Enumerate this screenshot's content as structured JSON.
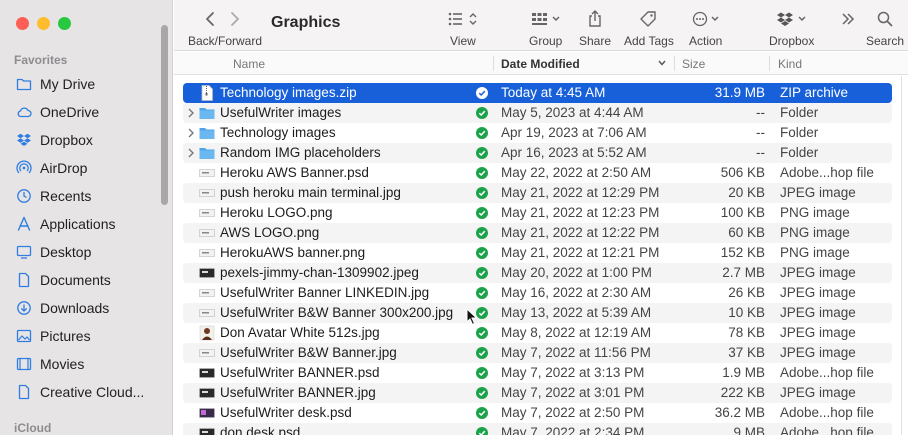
{
  "toolbar": {
    "title": "Graphics",
    "back_forward_label": "Back/Forward",
    "view_label": "View",
    "group_label": "Group",
    "share_label": "Share",
    "add_tags_label": "Add Tags",
    "action_label": "Action",
    "dropbox_label": "Dropbox",
    "search_label": "Search"
  },
  "sidebar": {
    "favorites_header": "Favorites",
    "icloud_header": "iCloud",
    "items": [
      {
        "label": "My Drive",
        "icon": "drive-folder-icon"
      },
      {
        "label": "OneDrive",
        "icon": "cloud-icon"
      },
      {
        "label": "Dropbox",
        "icon": "dropbox-icon"
      },
      {
        "label": "AirDrop",
        "icon": "airdrop-icon"
      },
      {
        "label": "Recents",
        "icon": "clock-icon"
      },
      {
        "label": "Applications",
        "icon": "applications-icon"
      },
      {
        "label": "Desktop",
        "icon": "desktop-icon"
      },
      {
        "label": "Documents",
        "icon": "document-icon"
      },
      {
        "label": "Downloads",
        "icon": "download-icon"
      },
      {
        "label": "Pictures",
        "icon": "pictures-icon"
      },
      {
        "label": "Movies",
        "icon": "movies-icon"
      },
      {
        "label": "Creative Cloud...",
        "icon": "file-icon"
      }
    ]
  },
  "columns": {
    "name": "Name",
    "date_modified": "Date Modified",
    "size": "Size",
    "kind": "Kind"
  },
  "files": [
    {
      "name": "Technology images.zip",
      "date": "Today at 4:45 AM",
      "size": "31.9 MB",
      "kind": "ZIP archive",
      "type": "zip",
      "selected": true
    },
    {
      "name": "UsefulWriter images",
      "date": "May 5, 2023 at 4:44 AM",
      "size": "--",
      "kind": "Folder",
      "type": "folder"
    },
    {
      "name": "Technology images",
      "date": "Apr 19, 2023 at 7:06 AM",
      "size": "--",
      "kind": "Folder",
      "type": "folder"
    },
    {
      "name": "Random IMG placeholders",
      "date": "Apr 16, 2023 at 5:52 AM",
      "size": "--",
      "kind": "Folder",
      "type": "folder"
    },
    {
      "name": "Heroku AWS Banner.psd",
      "date": "May 22, 2022 at 2:50 AM",
      "size": "506 KB",
      "kind": "Adobe...hop file",
      "type": "image"
    },
    {
      "name": "push heroku main terminal.jpg",
      "date": "May 21, 2022 at 12:29 PM",
      "size": "20 KB",
      "kind": "JPEG image",
      "type": "image"
    },
    {
      "name": "Heroku LOGO.png",
      "date": "May 21, 2022 at 12:23 PM",
      "size": "100 KB",
      "kind": "PNG image",
      "type": "image"
    },
    {
      "name": "AWS LOGO.png",
      "date": "May 21, 2022 at 12:22 PM",
      "size": "60 KB",
      "kind": "PNG image",
      "type": "image"
    },
    {
      "name": "HerokuAWS banner.png",
      "date": "May 21, 2022 at 12:21 PM",
      "size": "152 KB",
      "kind": "PNG image",
      "type": "image"
    },
    {
      "name": "pexels-jimmy-chan-1309902.jpeg",
      "date": "May 20, 2022 at 1:00 PM",
      "size": "2.7 MB",
      "kind": "JPEG image",
      "type": "image-dark"
    },
    {
      "name": "UsefulWriter Banner LINKEDIN.jpg",
      "date": "May 16, 2022 at 2:30 AM",
      "size": "26 KB",
      "kind": "JPEG image",
      "type": "image"
    },
    {
      "name": "UsefulWriter B&W Banner 300x200.jpg",
      "date": "May 13, 2022 at 5:39 AM",
      "size": "10 KB",
      "kind": "JPEG image",
      "type": "image"
    },
    {
      "name": "Don Avatar White 512s.jpg",
      "date": "May 8, 2022 at 12:19 AM",
      "size": "78 KB",
      "kind": "JPEG image",
      "type": "avatar"
    },
    {
      "name": "UsefulWriter B&W Banner.jpg",
      "date": "May 7, 2022 at 11:56 PM",
      "size": "37 KB",
      "kind": "JPEG image",
      "type": "image"
    },
    {
      "name": "UsefulWriter BANNER.psd",
      "date": "May 7, 2022 at 3:13 PM",
      "size": "1.9 MB",
      "kind": "Adobe...hop file",
      "type": "image-dark"
    },
    {
      "name": "UsefulWriter BANNER.jpg",
      "date": "May 7, 2022 at 3:01 PM",
      "size": "222 KB",
      "kind": "JPEG image",
      "type": "image-dark"
    },
    {
      "name": "UsefulWriter desk.psd",
      "date": "May 7, 2022 at 2:50 PM",
      "size": "36.2 MB",
      "kind": "Adobe...hop file",
      "type": "image-purple"
    },
    {
      "name": "don desk.psd",
      "date": "May 7, 2022 at 2:34 PM",
      "size": "9 MB",
      "kind": "Adobe...hop file",
      "type": "image-dark"
    }
  ],
  "colors": {
    "selection": "#1760da",
    "folder": "#4fa5e8",
    "sync_check": "#1aa34a",
    "sidebar_icon": "#2f7de0"
  }
}
